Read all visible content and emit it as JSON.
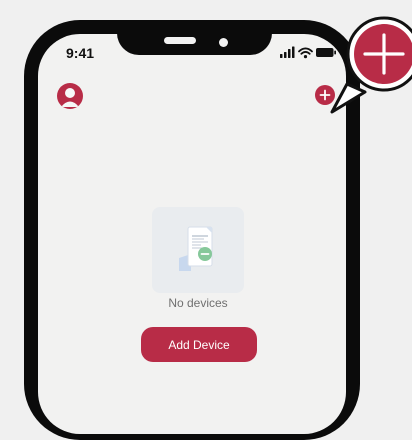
{
  "status_bar": {
    "time": "9:41"
  },
  "header": {
    "profile_icon": "user-avatar-icon",
    "add_icon": "plus-circle-icon"
  },
  "empty_state": {
    "illustration_icon": "empty-device-document-icon",
    "message": "No devices"
  },
  "actions": {
    "add_device_label": "Add Device"
  },
  "callout": {
    "icon": "plus-circle-icon"
  },
  "colors": {
    "accent": "#b82c47",
    "screen_background": "#f2f2f1",
    "phone_frame": "#0b0b0b",
    "page_background": "#f0f0f0"
  }
}
